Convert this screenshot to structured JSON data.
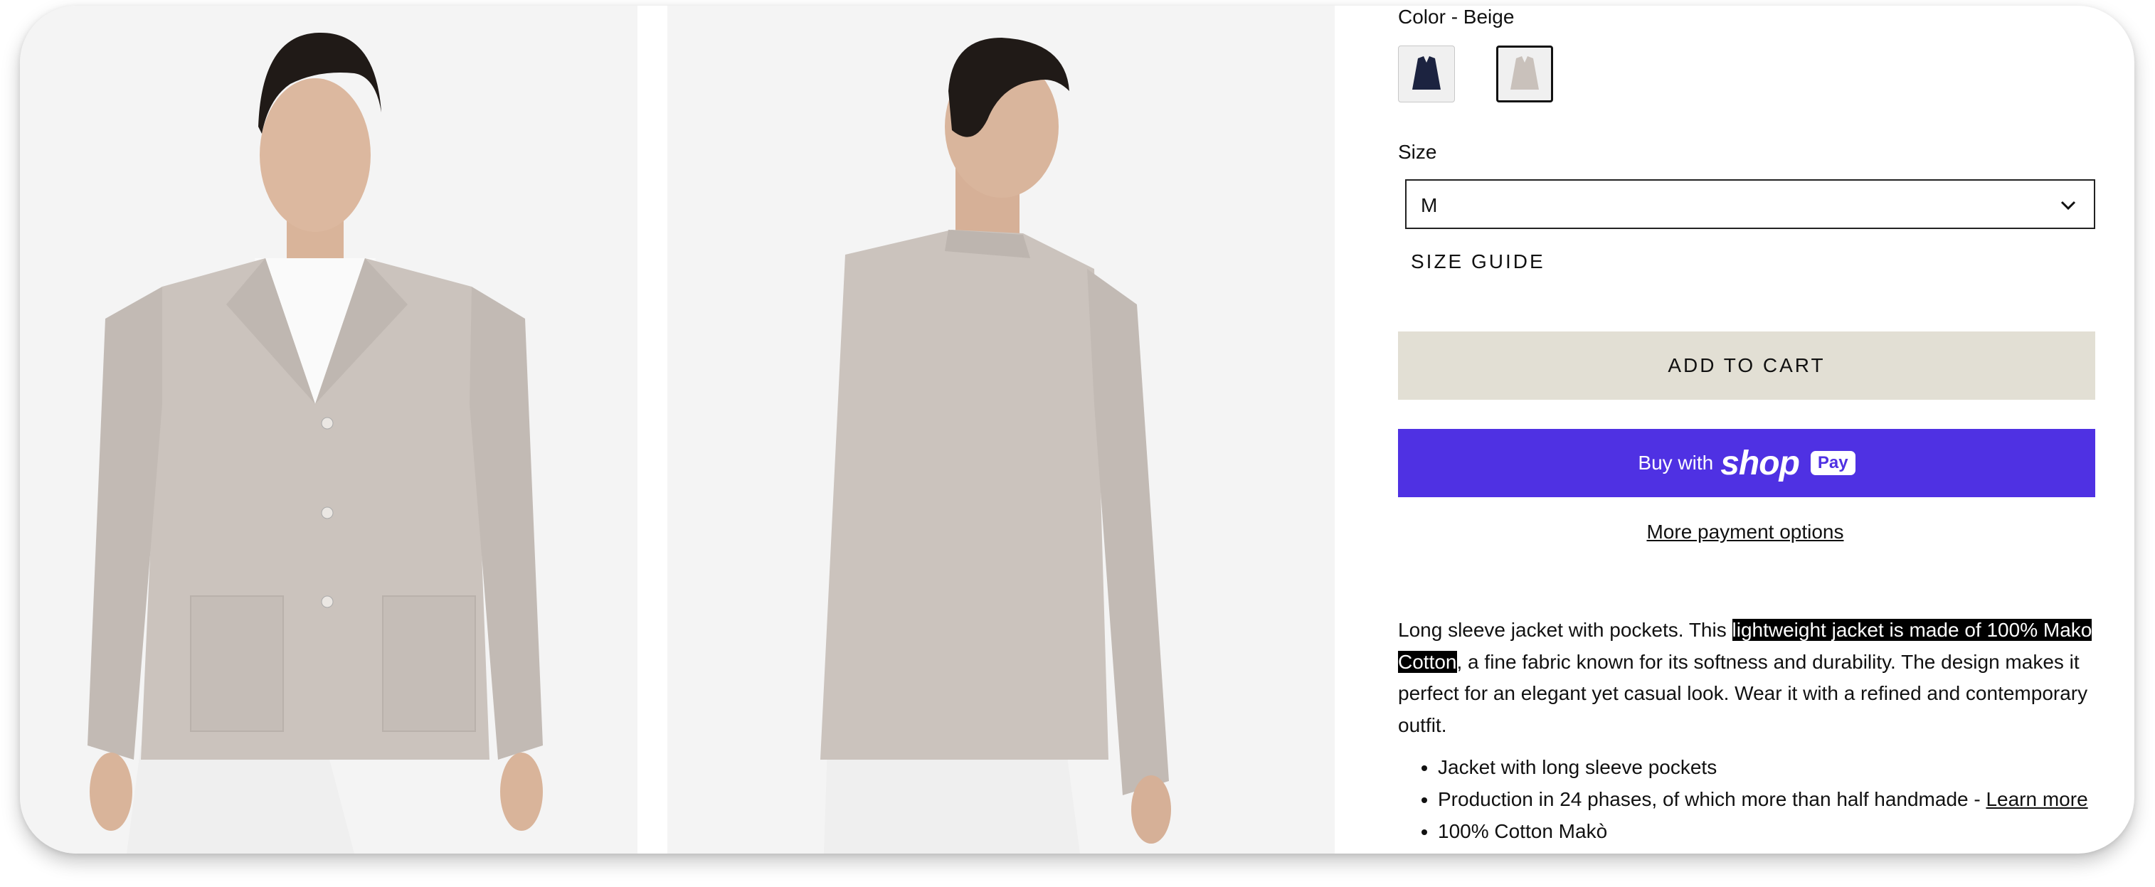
{
  "product": {
    "color_label": "Color - Beige",
    "swatches": [
      {
        "name": "navy",
        "color": "#1c2340"
      },
      {
        "name": "beige",
        "color": "#c9c1bb",
        "selected": true
      }
    ],
    "size_label": "Size",
    "size_value": "M",
    "size_guide": "SIZE GUIDE",
    "add_to_cart": "ADD TO CART",
    "buy_with": "Buy with",
    "shop_word": "shop",
    "pay_badge": "Pay",
    "more_payment": "More payment options",
    "description": {
      "before": "Long sleeve jacket with pockets. This ",
      "highlight": "lightweight jacket is made of 100% Mako Cotton",
      "after": ", a fine fabric known for its softness and durability. The design makes it perfect for an elegant yet casual look. Wear it with a refined and contemporary outfit."
    },
    "bullets": [
      "Jacket with long sleeve pockets",
      "Production in 24 phases, of which more than half handmade - ",
      "100% Cotton Makò"
    ],
    "learn_more": "Learn more"
  },
  "colors": {
    "shop_pay": "#4f31e3",
    "cart_button": "#e2dfd4",
    "photo_bg": "#f4f4f4",
    "jacket": "#c9c1bb"
  }
}
